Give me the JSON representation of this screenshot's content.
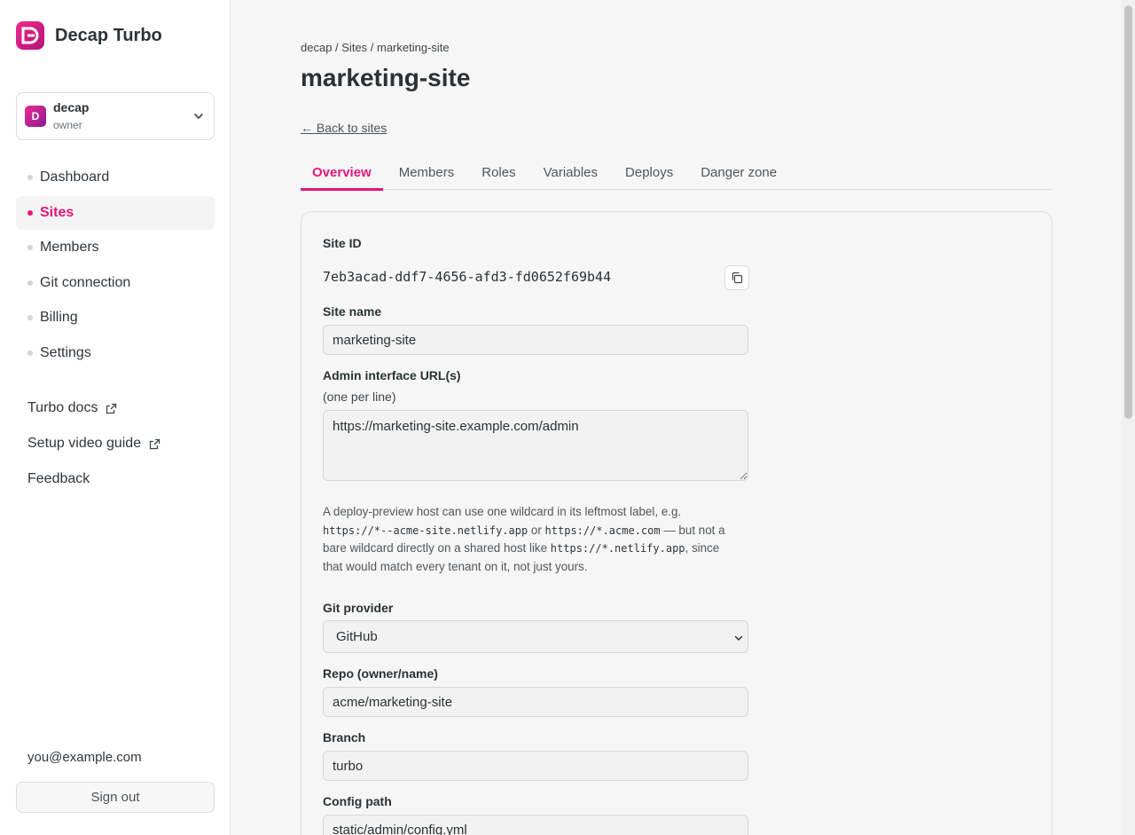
{
  "app": {
    "name": "Decap Turbo",
    "colors": {
      "accent": "#e6157d",
      "text": "#2b3236",
      "background": "#f6f6f6"
    }
  },
  "sidebar": {
    "org": {
      "initial": "D",
      "name": "decap",
      "role": "owner"
    },
    "nav": [
      {
        "label": "Dashboard",
        "active": false
      },
      {
        "label": "Sites",
        "active": true
      },
      {
        "label": "Members",
        "active": false
      },
      {
        "label": "Git connection",
        "active": false
      },
      {
        "label": "Billing",
        "active": false
      },
      {
        "label": "Settings",
        "active": false
      }
    ],
    "links": [
      {
        "label": "Turbo docs",
        "icon": "external-link-icon"
      },
      {
        "label": "Setup video guide",
        "icon": "external-link-icon"
      },
      {
        "label": "Feedback"
      }
    ],
    "user_email": "you@example.com",
    "signout_label": "Sign out"
  },
  "main": {
    "breadcrumb": "decap / Sites / marketing-site",
    "title": "marketing-site",
    "back_label": "← Back to sites",
    "tabs": [
      {
        "label": "Overview",
        "active": true
      },
      {
        "label": "Members",
        "active": false
      },
      {
        "label": "Roles",
        "active": false
      },
      {
        "label": "Variables",
        "active": false
      },
      {
        "label": "Deploys",
        "active": false
      },
      {
        "label": "Danger zone",
        "active": false
      }
    ],
    "form": {
      "site_id_label": "Site ID",
      "site_id": "7eb3acad-ddf7-4656-afd3-fd0652f69b44",
      "site_name_label": "Site name",
      "site_name": "marketing-site",
      "admin_url_label": "Admin interface URL(s)",
      "admin_url_hint": "(one per line)",
      "admin_url_value": "https://marketing-site.example.com/admin",
      "wildcard_note": {
        "t1": "A deploy-preview host can use one wildcard in its leftmost label, e.g. ",
        "c1": "https://*--acme-site.netlify.app",
        "t2": " or ",
        "c2": "https://*.acme.com",
        "t3": " — but not a bare wildcard directly on a shared host like ",
        "c3": "https://*.netlify.app",
        "t4": ", since that would match every tenant on it, not just yours."
      },
      "git_provider_label": "Git provider",
      "git_provider_value": "GitHub",
      "repo_label": "Repo (owner/name)",
      "repo_value": "acme/marketing-site",
      "branch_label": "Branch",
      "branch_value": "turbo",
      "config_path_label": "Config path",
      "config_path_value": "static/admin/config.yml"
    }
  }
}
